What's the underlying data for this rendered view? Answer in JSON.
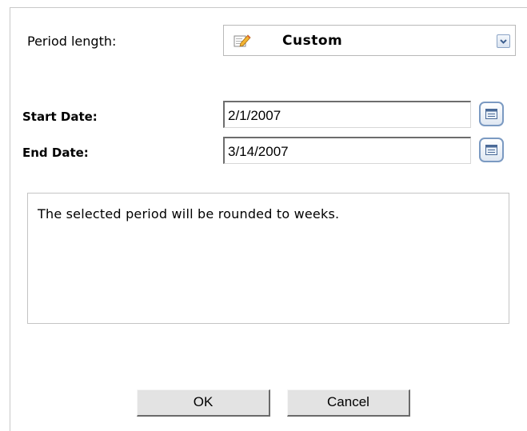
{
  "period": {
    "label": "Period length:",
    "selected_value": "Custom",
    "icon": "pencil-icon",
    "dropdown_icon": "chevron-down-icon"
  },
  "start": {
    "label": "Start Date:",
    "value": "2/1/2007",
    "calendar_icon": "calendar-icon"
  },
  "end": {
    "label": "End Date:",
    "value": "3/14/2007",
    "calendar_icon": "calendar-icon"
  },
  "message": "The selected period will be rounded to weeks.",
  "buttons": {
    "ok_label": "OK",
    "cancel_label": "Cancel"
  },
  "colors": {
    "border": "#c8c8c8",
    "accent_blue": "#7b9ac2",
    "button_face": "#e3e3e3"
  }
}
